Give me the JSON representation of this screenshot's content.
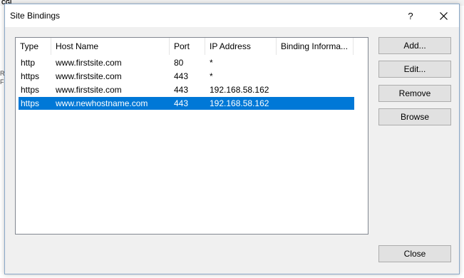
{
  "dialog": {
    "title": "Site Bindings",
    "help_label": "?",
    "close_glyph": "✕"
  },
  "columns": [
    "Type",
    "Host Name",
    "Port",
    "IP Address",
    "Binding Informa..."
  ],
  "rows": [
    {
      "type": "http",
      "host": "www.firstsite.com",
      "port": "80",
      "ip": "*",
      "info": "",
      "selected": false
    },
    {
      "type": "https",
      "host": "www.firstsite.com",
      "port": "443",
      "ip": "*",
      "info": "",
      "selected": false
    },
    {
      "type": "https",
      "host": "www.firstsite.com",
      "port": "443",
      "ip": "192.168.58.162",
      "info": "",
      "selected": false
    },
    {
      "type": "https",
      "host": "www.newhostname.com",
      "port": "443",
      "ip": "192.168.58.162",
      "info": "",
      "selected": true
    }
  ],
  "buttons": {
    "add": "Add...",
    "edit": "Edit...",
    "remove": "Remove",
    "browse": "Browse",
    "close": "Close"
  },
  "background": {
    "left_fragment_1": "R",
    "left_fragment_2": "Fi",
    "top_fragment": "CGI"
  },
  "colors": {
    "selection": "#0078d7",
    "dialog_bg": "#f0f0f0",
    "button_bg": "#e1e1e1"
  }
}
